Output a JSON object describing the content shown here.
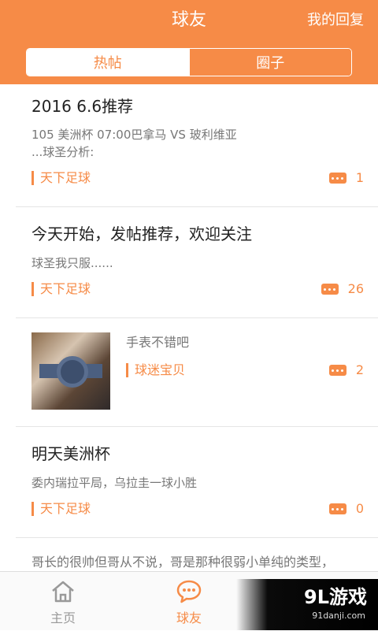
{
  "header": {
    "title": "球友",
    "right_action": "我的回复",
    "tabs": [
      {
        "label": "热帖",
        "active": true
      },
      {
        "label": "圈子",
        "active": false
      }
    ]
  },
  "posts": [
    {
      "title": "2016 6.6推荐",
      "body_lines": [
        "105    美洲杯  07:00巴拿马 VS 玻利维亚",
        "...球圣分析:"
      ],
      "tag": "天下足球",
      "comment_count": "1"
    },
    {
      "title": "今天开始，发帖推荐，欢迎关注",
      "body_lines": [
        "球圣我只服......"
      ],
      "tag": "天下足球",
      "comment_count": "26"
    },
    {
      "title": "",
      "body_lines": [
        "手表不错吧"
      ],
      "tag": "球迷宝贝",
      "comment_count": "2",
      "has_image": true
    },
    {
      "title": "明天美洲杯",
      "body_lines": [
        "委内瑞拉平局，乌拉圭一球小胜"
      ],
      "tag": "天下足球",
      "comment_count": "0"
    },
    {
      "title": "",
      "body_lines": [
        "哥长的很帅但哥从不说，哥是那种很弱小单纯的类型，"
      ],
      "tag": "",
      "comment_count": ""
    }
  ],
  "tabbar": {
    "items": [
      {
        "label": "主页",
        "icon": "home-icon",
        "active": false
      },
      {
        "label": "球友",
        "icon": "chat-icon",
        "active": true
      },
      {
        "label": "",
        "icon": "profile-icon",
        "active": false
      }
    ]
  },
  "watermark": {
    "main": "9L游戏",
    "sub": "91danji.com"
  },
  "colors": {
    "accent": "#f68b47",
    "text_primary": "#222222",
    "text_secondary": "#777777",
    "tab_inactive": "#999999"
  }
}
